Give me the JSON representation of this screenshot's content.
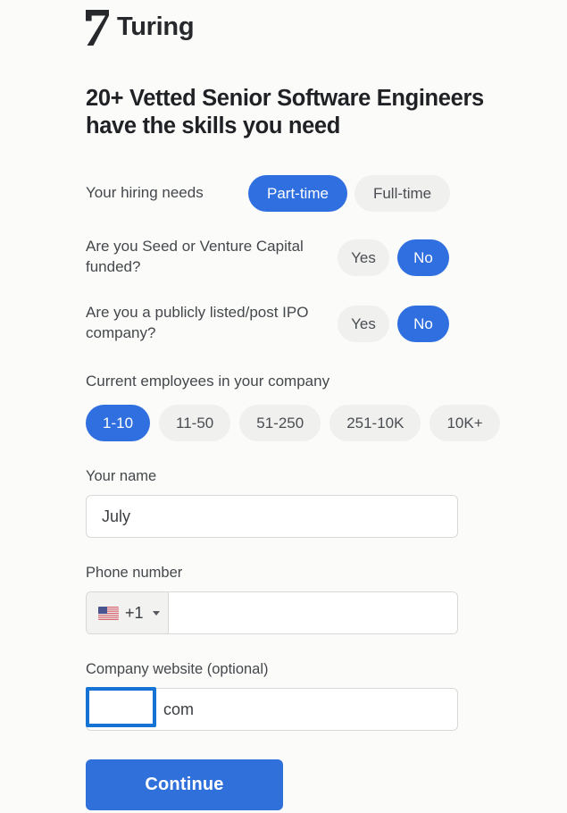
{
  "brand": {
    "name": "Turing",
    "logo_icon": "turing-seven-logo-icon",
    "logo_color": "#26282b"
  },
  "headline": "20+ Vetted Senior Software Engineers have the skills you need",
  "colors": {
    "accent_blue": "#2f6fe0",
    "button_blue": "#3070da",
    "pill_unselected_bg": "#f0f0ef",
    "pill_unselected_text": "#4a4d52",
    "page_bg": "#fbfbfa",
    "focus_outline": "#1573d6"
  },
  "hiring_needs": {
    "label": "Your hiring needs",
    "options": [
      {
        "label": "Part-time",
        "selected": true
      },
      {
        "label": "Full-time",
        "selected": false
      }
    ]
  },
  "questions": [
    {
      "id": "seed-venture-funded",
      "label": "Are you Seed or Venture Capital funded?",
      "options": [
        {
          "label": "Yes",
          "selected": false
        },
        {
          "label": "No",
          "selected": true
        }
      ]
    },
    {
      "id": "publicly-listed",
      "label": "Are you a publicly listed/post IPO company?",
      "options": [
        {
          "label": "Yes",
          "selected": false
        },
        {
          "label": "No",
          "selected": true
        }
      ]
    }
  ],
  "employees": {
    "label": "Current employees in your company",
    "options": [
      {
        "label": "1-10",
        "selected": true
      },
      {
        "label": "11-50",
        "selected": false
      },
      {
        "label": "51-250",
        "selected": false
      },
      {
        "label": "251-10K",
        "selected": false
      },
      {
        "label": "10K+",
        "selected": false
      }
    ]
  },
  "name_field": {
    "label": "Your name",
    "value": "July",
    "placeholder": ""
  },
  "phone_field": {
    "label": "Phone number",
    "country_flag_icon": "us-flag-icon",
    "dial_code": "+1",
    "dropdown_icon": "caret-down-icon",
    "value": "",
    "placeholder": ""
  },
  "website_field": {
    "label": "Company website (optional)",
    "visible_text": "com",
    "placeholder": "",
    "focus_overlay": true
  },
  "continue_button": {
    "label": "Continue"
  }
}
